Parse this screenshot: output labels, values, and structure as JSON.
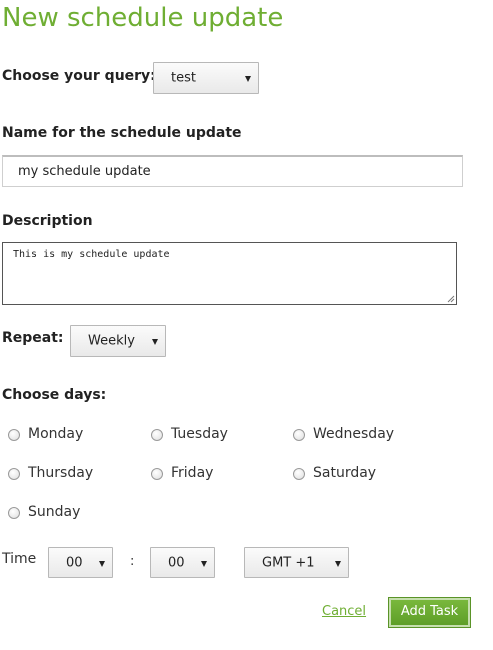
{
  "page": {
    "title": "New schedule update"
  },
  "query": {
    "label": "Choose your query:",
    "selected": "test"
  },
  "name": {
    "label": "Name for the schedule update",
    "value": "my schedule update"
  },
  "description": {
    "label": "Description",
    "value": "This is my schedule update"
  },
  "repeat": {
    "label": "Repeat:",
    "selected": "Weekly"
  },
  "days": {
    "label": "Choose days:",
    "items": [
      {
        "label": "Monday",
        "checked": false
      },
      {
        "label": "Tuesday",
        "checked": false
      },
      {
        "label": "Wednesday",
        "checked": false
      },
      {
        "label": "Thursday",
        "checked": false
      },
      {
        "label": "Friday",
        "checked": false
      },
      {
        "label": "Saturday",
        "checked": false
      },
      {
        "label": "Sunday",
        "checked": false
      }
    ]
  },
  "time": {
    "label": "Time",
    "hour": "00",
    "separator": ":",
    "minute": "00",
    "timezone": "GMT +1"
  },
  "actions": {
    "cancel_label": "Cancel",
    "submit_label": "Add Task"
  }
}
